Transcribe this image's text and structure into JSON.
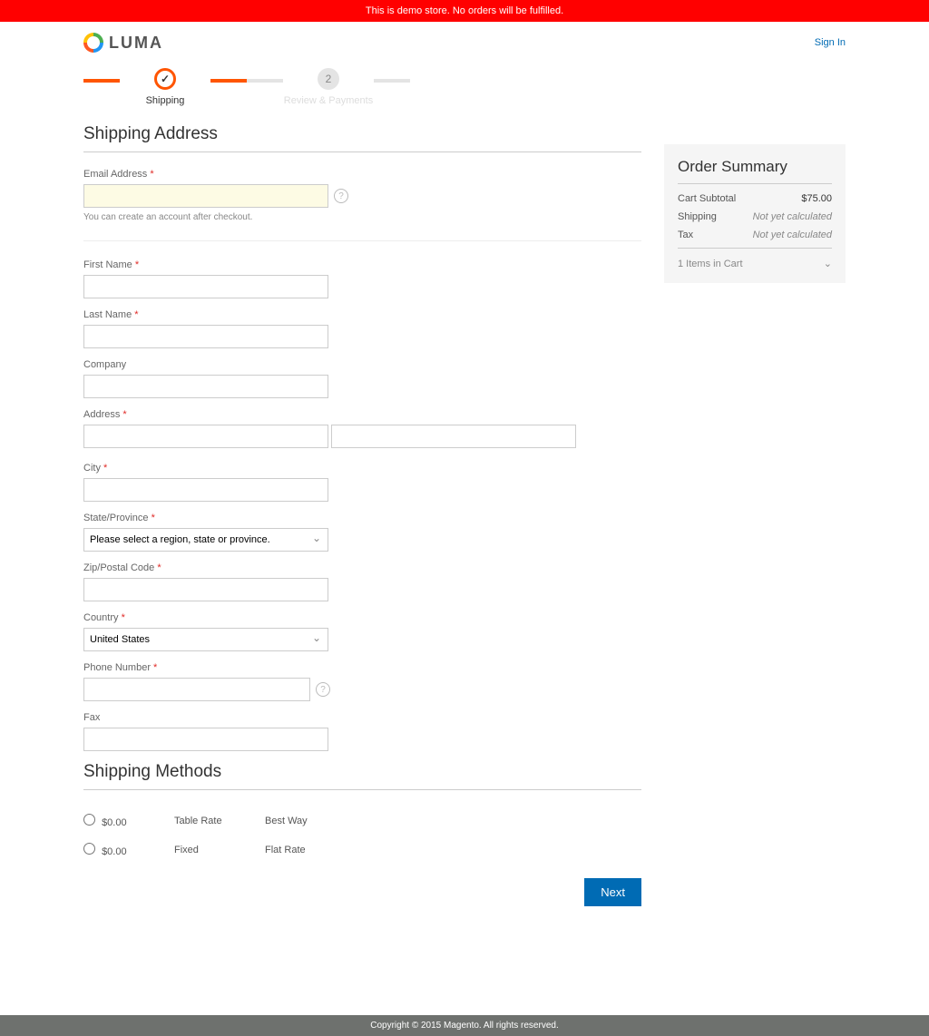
{
  "banner": "This is demo store. No orders will be fulfilled.",
  "brand": "LUMA",
  "signin": "Sign In",
  "progress": {
    "step1": "Shipping",
    "step2_num": "2",
    "step2": "Review & Payments"
  },
  "section1_title": "Shipping Address",
  "email": {
    "label": "Email Address",
    "note": "You can create an account after checkout."
  },
  "fields": {
    "firstname": "First Name",
    "lastname": "Last Name",
    "company": "Company",
    "address": "Address",
    "city": "City",
    "state": "State/Province",
    "state_placeholder": "Please select a region, state or province.",
    "zip": "Zip/Postal Code",
    "country": "Country",
    "country_value": "United States",
    "phone": "Phone Number",
    "fax": "Fax"
  },
  "section2_title": "Shipping Methods",
  "methods": [
    {
      "price": "$0.00",
      "carrier": "Table Rate",
      "title": "Best Way"
    },
    {
      "price": "$0.00",
      "carrier": "Fixed",
      "title": "Flat Rate"
    }
  ],
  "next": "Next",
  "summary": {
    "title": "Order Summary",
    "subtotal_label": "Cart Subtotal",
    "subtotal": "$75.00",
    "shipping_label": "Shipping",
    "shipping": "Not yet calculated",
    "tax_label": "Tax",
    "tax": "Not yet calculated",
    "items": "1 Items in Cart"
  },
  "footer": "Copyright © 2015 Magento. All rights reserved."
}
